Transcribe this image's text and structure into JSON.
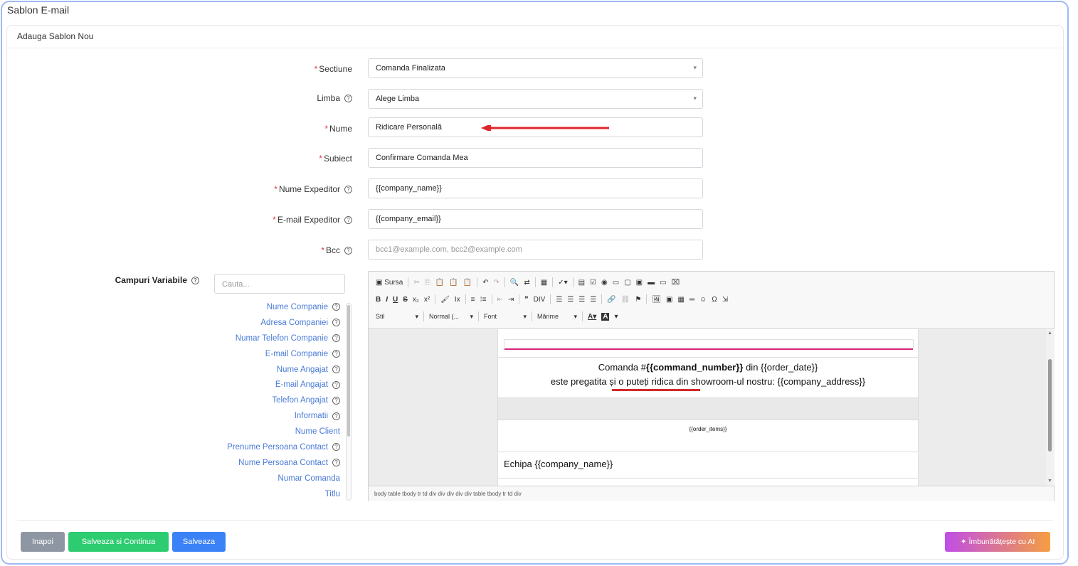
{
  "page": {
    "title": "Sablon E-mail"
  },
  "card": {
    "header": "Adauga Sablon Nou"
  },
  "form": {
    "sectiune": {
      "label": "Sectiune",
      "required": true,
      "value": "Comanda Finalizata"
    },
    "limba": {
      "label": "Limba",
      "required": false,
      "value": "Alege Limba"
    },
    "nume": {
      "label": "Nume",
      "required": true,
      "value": "Ridicare Personală"
    },
    "subiect": {
      "label": "Subiect",
      "required": true,
      "value": "Confirmare Comanda Mea"
    },
    "nume_expeditor": {
      "label": "Nume Expeditor",
      "required": true,
      "value": "{{company_name}}"
    },
    "email_expeditor": {
      "label": "E-mail Expeditor",
      "required": true,
      "value": "{{company_email}}"
    },
    "bcc": {
      "label": "Bcc",
      "required": true,
      "value": "",
      "placeholder": "bcc1@example.com, bcc2@example.com"
    }
  },
  "variables": {
    "label": "Campuri Variabile",
    "search_placeholder": "Cauta...",
    "items": [
      {
        "label": "Nume Companie",
        "help": true
      },
      {
        "label": "Adresa Companiei",
        "help": true
      },
      {
        "label": "Numar Telefon Companie",
        "help": true
      },
      {
        "label": "E-mail Companie",
        "help": true
      },
      {
        "label": "Nume Angajat",
        "help": true
      },
      {
        "label": "E-mail Angajat",
        "help": true
      },
      {
        "label": "Telefon Angajat",
        "help": true
      },
      {
        "label": "Informatii",
        "help": true
      },
      {
        "label": "Nume Client",
        "help": false
      },
      {
        "label": "Prenume Persoana Contact",
        "help": true
      },
      {
        "label": "Nume Persoana Contact",
        "help": true
      },
      {
        "label": "Numar Comanda",
        "help": false
      },
      {
        "label": "Titlu",
        "help": false
      }
    ]
  },
  "editor": {
    "toolbar": {
      "source_label": "Sursa",
      "style_label": "Stil",
      "format_label": "Normal (...",
      "font_label": "Font",
      "size_label": "Mărime"
    },
    "content": {
      "line1_prefix": "Comanda #",
      "line1_bold": "{{command_number}}",
      "line1_suffix": " din {{order_date}}",
      "line2": "este pregatita și o puteți ridica din showroom-ul nostru: {{company_address}}",
      "order_items": "{{order_items}}",
      "team": "Echipa {{company_name}}"
    },
    "statusbar": "body  table  tbody  tr  td  div  div  div  div  div  table  tbody  tr  td  div"
  },
  "buttons": {
    "back": "Inapoi",
    "save_continue": "Salveaza si Continua",
    "save": "Salveaza",
    "ai": "Îmbunătățește cu AI"
  },
  "colors": {
    "link": "#4a7bd8",
    "required": "#e4394a",
    "save_continue": "#2ecc71",
    "save": "#3b82f6",
    "back": "#8f96a3",
    "annotation": "#e0262b"
  }
}
